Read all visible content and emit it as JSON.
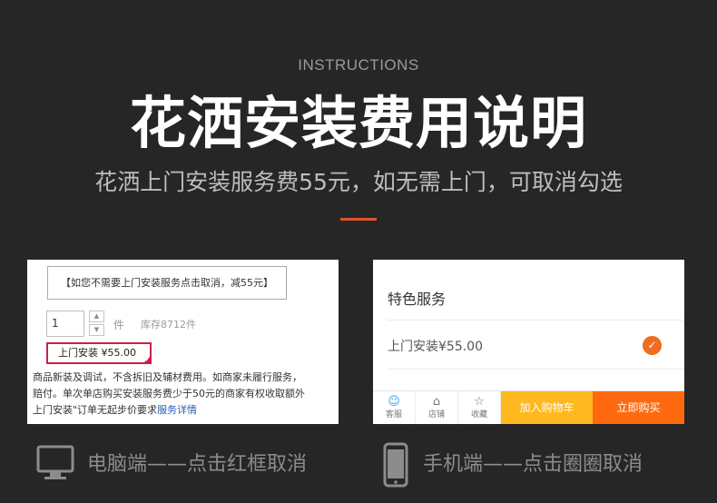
{
  "header": {
    "kicker": "INSTRUCTIONS",
    "title": "花洒安装费用说明",
    "subtitle": "花洒上门安装服务费55元，如无需上门，可取消勾选"
  },
  "desktop": {
    "notice": "【如您不需要上门安装服务点击取消，减55元】",
    "qty_value": "1",
    "step_up": "▲",
    "step_down": "▼",
    "unit": "件",
    "stock": "库存8712件",
    "option_label": "上门安装  ¥55.00",
    "option_check": "✓",
    "desc_line1": "商品新装及调试，不含拆旧及辅材费用。如商家未履行服务，",
    "desc_line2": "赔付。单次单店购买安装服务费少于50元的商家有权收取额外",
    "desc_line3_prefix": "上门安装\"订单无起步价要求",
    "desc_link": "服务详情"
  },
  "mobile": {
    "section_title": "特色服务",
    "service_label": "上门安装¥55.00",
    "check": "✓",
    "tabs": [
      {
        "label": "客服",
        "icon": "☺"
      },
      {
        "label": "店铺",
        "icon": "⌂"
      },
      {
        "label": "收藏",
        "icon": "☆"
      }
    ],
    "add_to_cart": "加入购物车",
    "buy_now": "立即购买"
  },
  "captions": {
    "pc": "电脑端——点击红框取消",
    "mobile": "手机端——点击圈圈取消"
  },
  "colors": {
    "background": "#262626",
    "accent": "#e0552d",
    "select_border": "#cc1f47",
    "check_orange": "#f06c1e",
    "cart_yellow": "#ffb81f",
    "buy_orange": "#ff6a10"
  }
}
